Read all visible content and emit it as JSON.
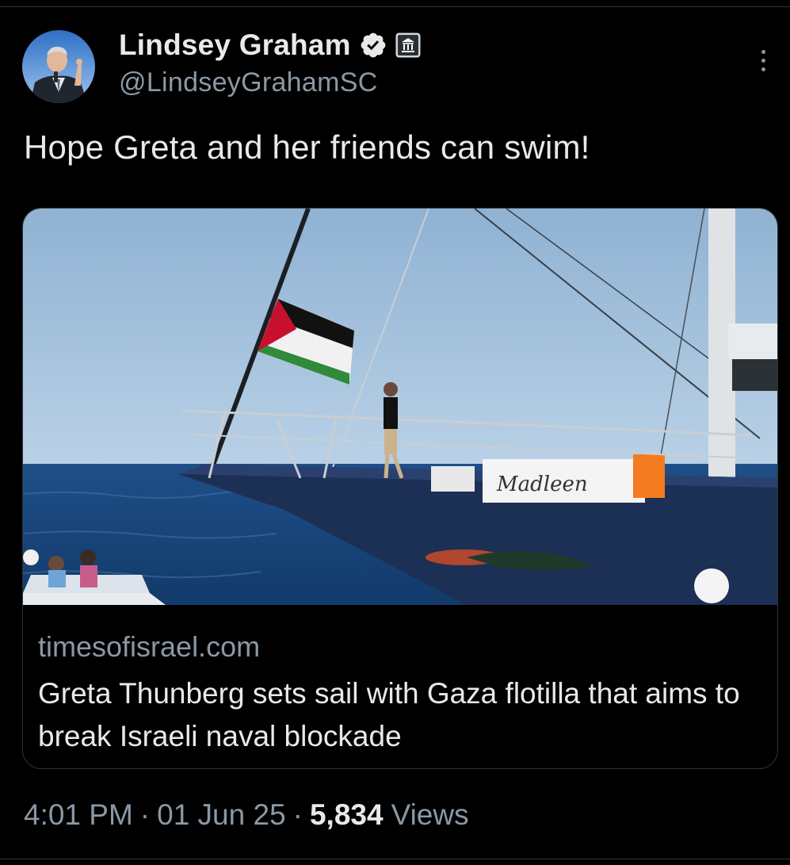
{
  "author": {
    "display_name": "Lindsey Graham",
    "handle": "@LindseyGrahamSC",
    "verified_icon": "verified-badge-icon",
    "affiliation_icon": "government-building-icon",
    "avatar_icon": "avatar"
  },
  "tweet": {
    "text": "Hope Greta and her friends can swim!"
  },
  "card": {
    "image_boat_name": "Madleen",
    "domain": "timesofisrael.com",
    "title": "Greta Thunberg sets sail with Gaza flotilla that aims to break Israeli naval blockade"
  },
  "meta": {
    "time": "4:01 PM",
    "separator": "·",
    "date": "01 Jun 25",
    "views_count": "5,834",
    "views_label": "Views"
  },
  "colors": {
    "background": "#000000",
    "text_primary": "#e7e9ea",
    "text_secondary": "#8b98a5",
    "border": "#2f3336",
    "verified_blue": "#1d9bf0"
  },
  "icons": {
    "more": "more-options-icon"
  }
}
